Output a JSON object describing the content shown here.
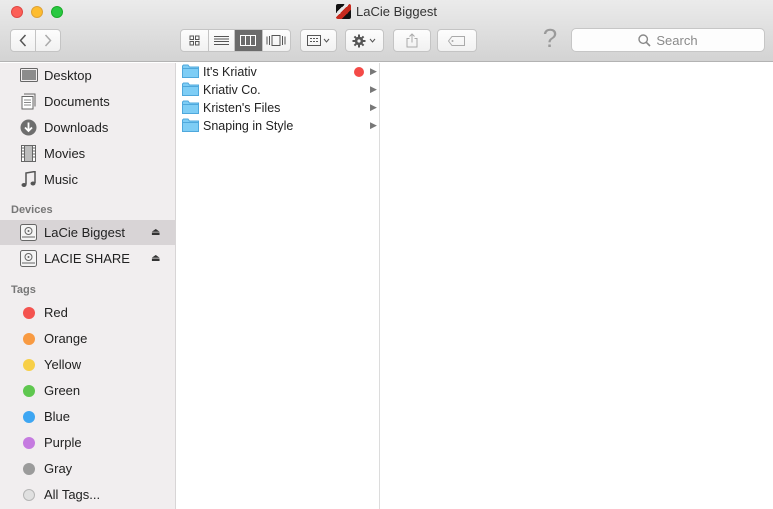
{
  "window": {
    "title": "LaCie Biggest"
  },
  "toolbar": {
    "back_label": "‹",
    "forward_label": "›",
    "help_label": "?",
    "search_placeholder": "Search"
  },
  "sidebar": {
    "favorites": [
      {
        "label": "Desktop",
        "icon": "desktop-icon"
      },
      {
        "label": "Documents",
        "icon": "documents-icon"
      },
      {
        "label": "Downloads",
        "icon": "downloads-icon"
      },
      {
        "label": "Movies",
        "icon": "movies-icon"
      },
      {
        "label": "Music",
        "icon": "music-icon"
      }
    ],
    "devices_header": "Devices",
    "devices": [
      {
        "label": "LaCie Biggest",
        "icon": "hard-drive-icon",
        "selected": true,
        "eject": "⏏"
      },
      {
        "label": "LACIE SHARE",
        "icon": "hard-drive-icon",
        "selected": false,
        "eject": "⏏"
      }
    ],
    "tags_header": "Tags",
    "tags": [
      {
        "label": "Red",
        "color": "#f4534f"
      },
      {
        "label": "Orange",
        "color": "#f89a42"
      },
      {
        "label": "Yellow",
        "color": "#f7cf47"
      },
      {
        "label": "Green",
        "color": "#5fc74f"
      },
      {
        "label": "Blue",
        "color": "#3ea6f2"
      },
      {
        "label": "Purple",
        "color": "#c57be0"
      },
      {
        "label": "Gray",
        "color": "#9b9b9b"
      },
      {
        "label": "All Tags...",
        "color": "#e0e0e0"
      }
    ]
  },
  "column1": {
    "items": [
      {
        "name": "It's Kriativ",
        "tag_color": "#f44a47"
      },
      {
        "name": "Kriativ Co."
      },
      {
        "name": "Kristen's Files"
      },
      {
        "name": "Snaping in Style"
      }
    ]
  }
}
